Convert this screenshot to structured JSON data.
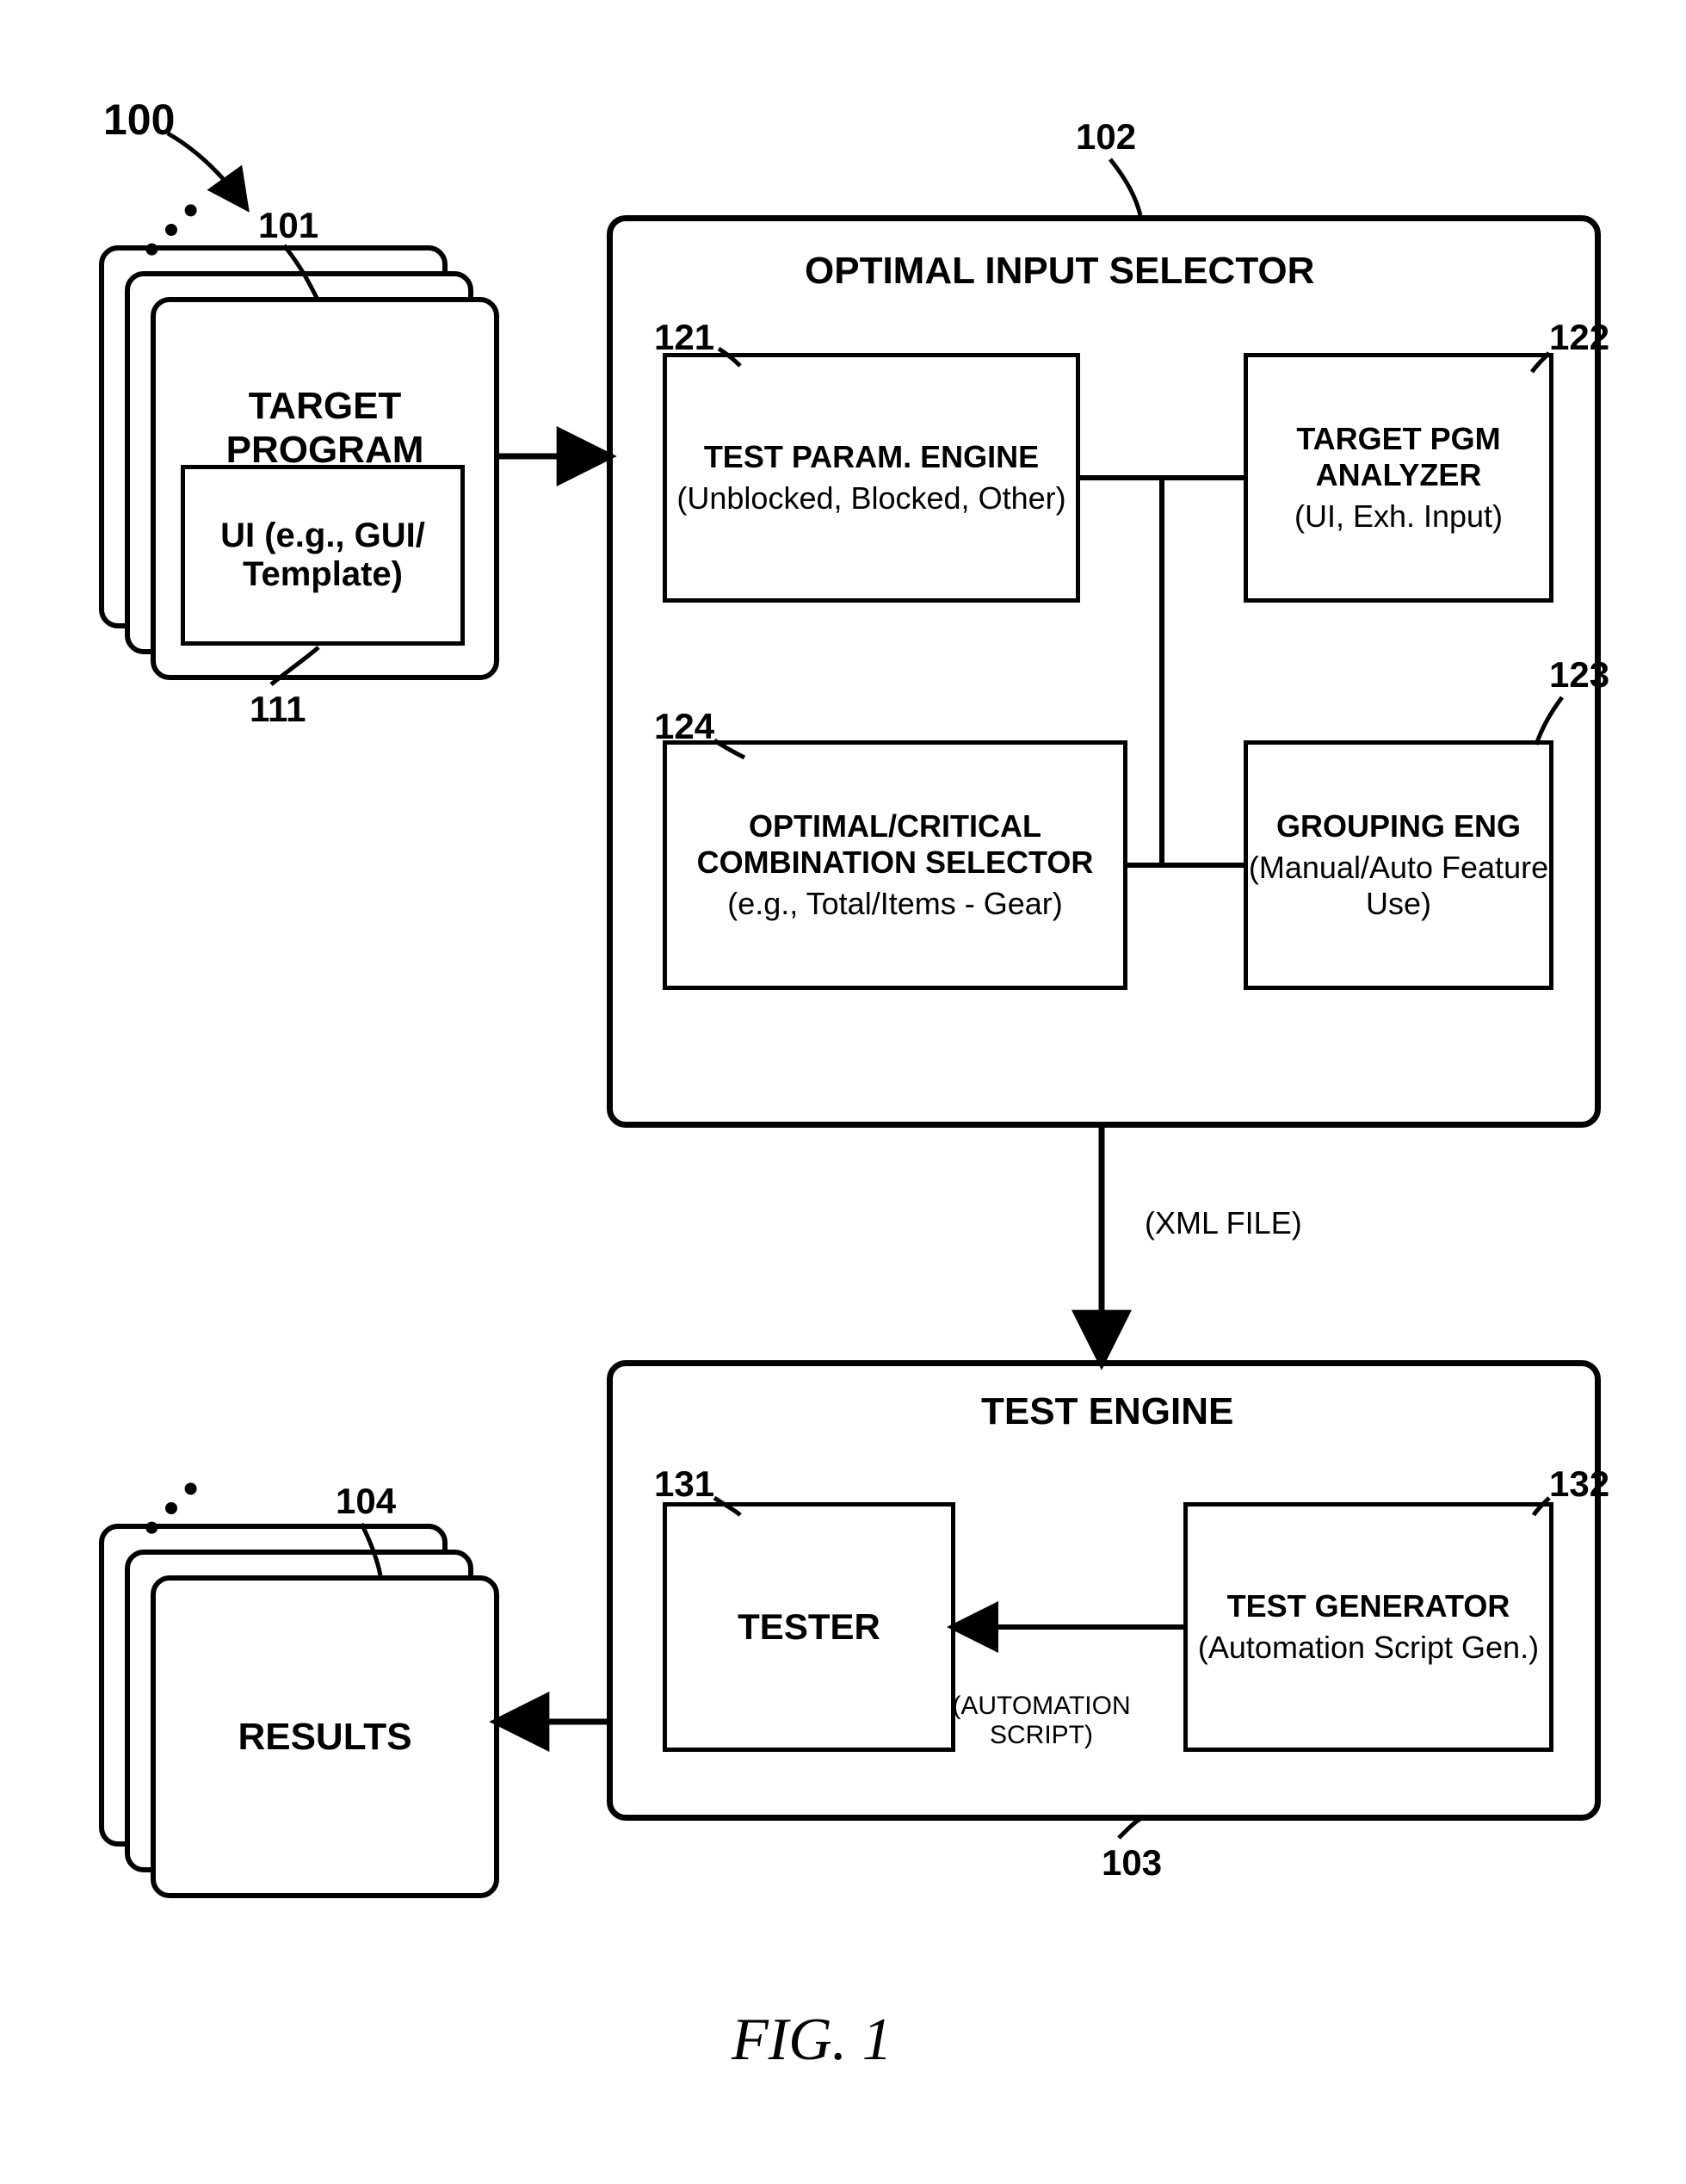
{
  "figure": {
    "number_ref": "100",
    "caption": "FIG. 1"
  },
  "target_program": {
    "ref": "101",
    "title": "TARGET PROGRAM",
    "ui_box": {
      "ref": "111",
      "text": "UI (e.g., GUI/ Template)"
    }
  },
  "optimal_input_selector": {
    "ref": "102",
    "title": "OPTIMAL INPUT SELECTOR",
    "test_param_engine": {
      "ref": "121",
      "line1": "TEST PARAM. ENGINE",
      "line2": "(Unblocked, Blocked, Other)"
    },
    "target_pgm_analyzer": {
      "ref": "122",
      "line1": "TARGET PGM ANALYZER",
      "line2": "(UI, Exh. Input)"
    },
    "grouping_eng": {
      "ref": "123",
      "line1": "GROUPING ENG",
      "line2": "(Manual/Auto Feature Use)"
    },
    "combination_selector": {
      "ref": "124",
      "line1": "OPTIMAL/CRITICAL COMBINATION SELECTOR",
      "line2": "(e.g., Total/Items - Gear)"
    }
  },
  "xml_file_label": "(XML FILE)",
  "test_engine": {
    "ref": "103",
    "title": "TEST ENGINE",
    "tester": {
      "ref": "131",
      "text": "TESTER"
    },
    "test_generator": {
      "ref": "132",
      "line1": "TEST GENERATOR",
      "line2": "(Automation Script Gen.)"
    },
    "automation_script_label": "(AUTOMATION SCRIPT)"
  },
  "results": {
    "ref": "104",
    "title": "RESULTS"
  }
}
